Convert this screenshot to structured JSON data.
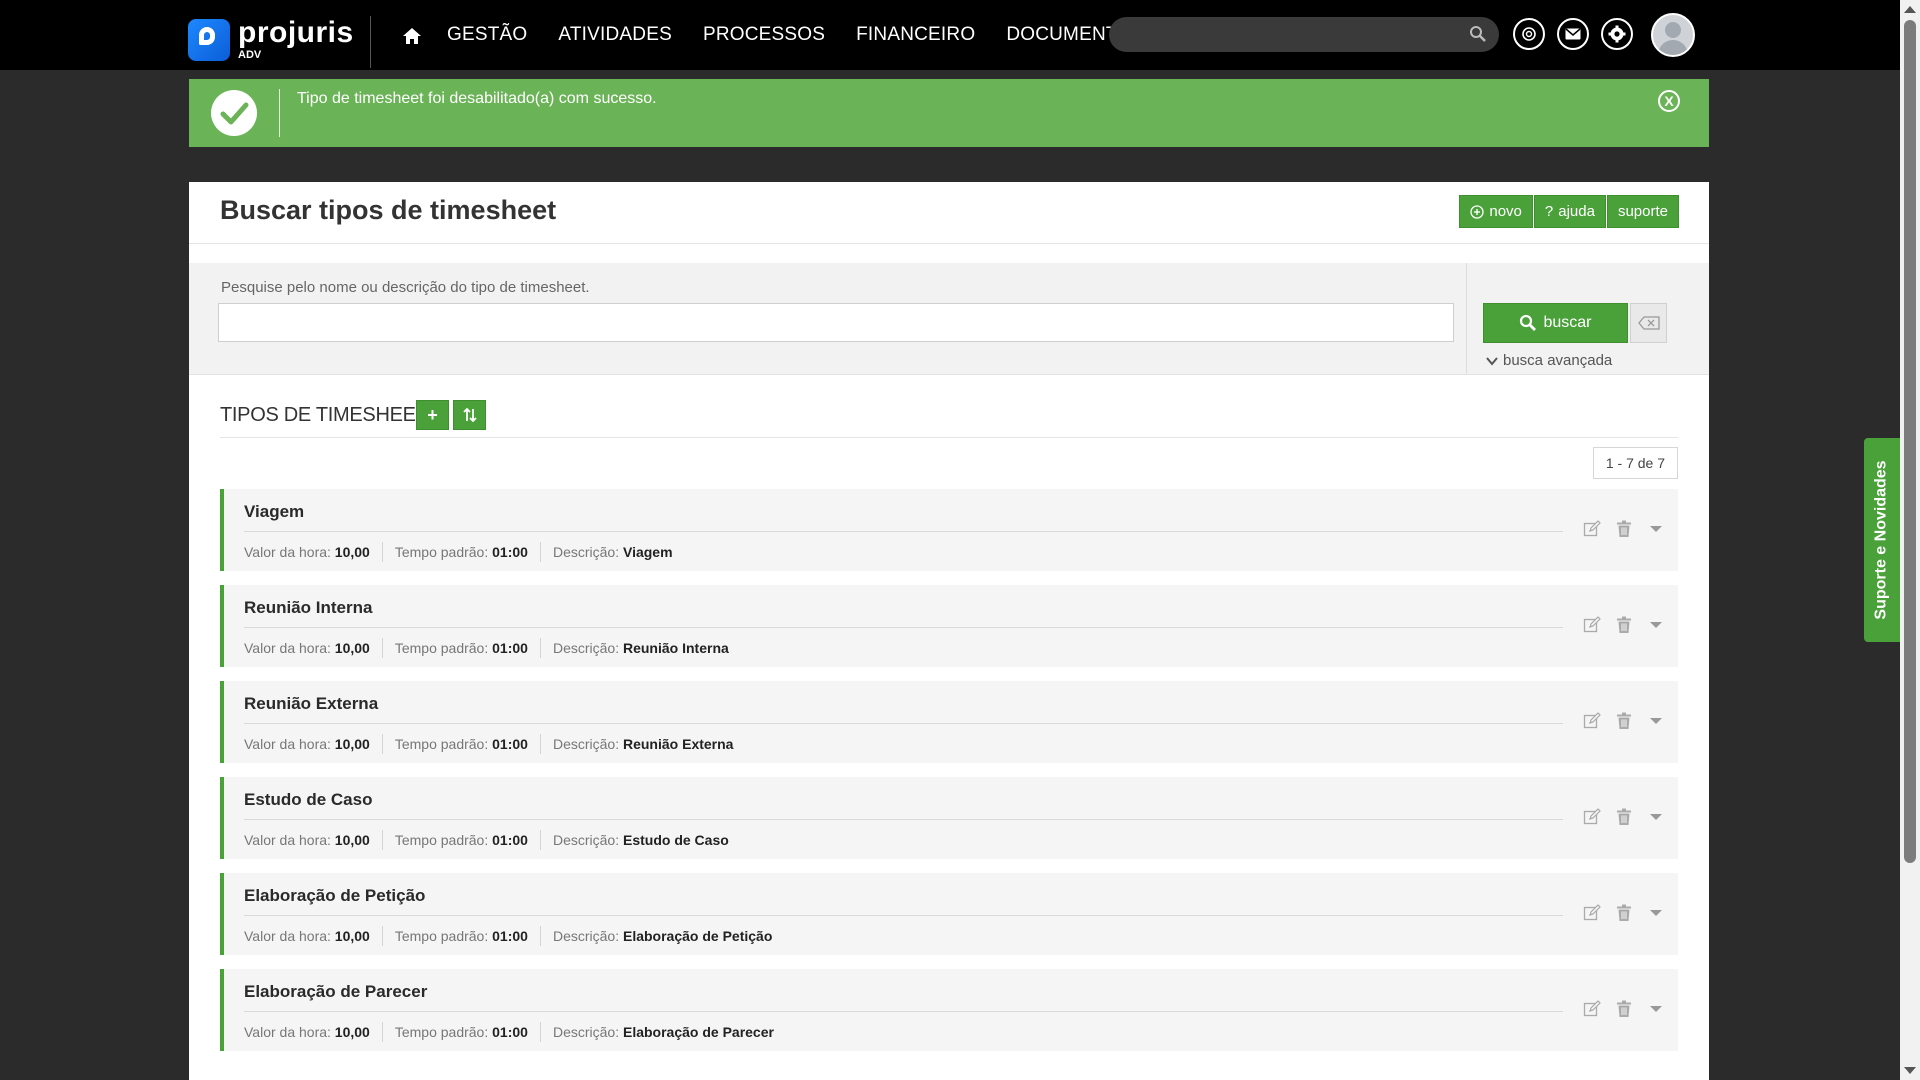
{
  "header": {
    "logo_name": "projuris",
    "logo_sub": "ADV",
    "nav": [
      "GESTÃO",
      "ATIVIDADES",
      "PROCESSOS",
      "FINANCEIRO",
      "DOCUMENTOS"
    ],
    "search_placeholder": ""
  },
  "alert": {
    "message": "Tipo de timesheet foi desabilitado(a) com sucesso.",
    "close_label": "X"
  },
  "page": {
    "title": "Buscar tipos de timesheet",
    "buttons": {
      "novo": "novo",
      "ajuda": "ajuda",
      "suporte": "suporte"
    }
  },
  "search": {
    "label": "Pesquise pelo nome ou descrição do tipo de timesheet.",
    "value": "",
    "button": "buscar",
    "advanced": "busca avançada"
  },
  "list": {
    "title": "TIPOS DE TIMESHEET",
    "pagination": "1 - 7 de 7",
    "labels": {
      "valor": "Valor da hora:",
      "tempo": "Tempo padrão:",
      "descricao": "Descrição:"
    },
    "items": [
      {
        "name": "Viagem",
        "valor": "10,00",
        "tempo": "01:00",
        "descricao": "Viagem"
      },
      {
        "name": "Reunião Interna",
        "valor": "10,00",
        "tempo": "01:00",
        "descricao": "Reunião Interna"
      },
      {
        "name": "Reunião Externa",
        "valor": "10,00",
        "tempo": "01:00",
        "descricao": "Reunião Externa"
      },
      {
        "name": "Estudo de Caso",
        "valor": "10,00",
        "tempo": "01:00",
        "descricao": "Estudo de Caso"
      },
      {
        "name": "Elaboração de Petição",
        "valor": "10,00",
        "tempo": "01:00",
        "descricao": "Elaboração de Petição"
      },
      {
        "name": "Elaboração de Parecer",
        "valor": "10,00",
        "tempo": "01:00",
        "descricao": "Elaboração de Parecer"
      }
    ]
  },
  "support_tab": "Suporte e Novidades",
  "colors": {
    "brand_green": "#4aa13a",
    "alert_green": "#6bb357",
    "topbar": "#000000",
    "logo_blue": "#1e88ff"
  }
}
